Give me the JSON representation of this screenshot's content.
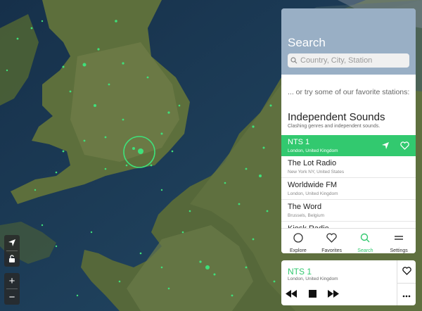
{
  "colors": {
    "accent": "#32c96f",
    "map_dot": "#3fe07a",
    "sea": "#1c3a55"
  },
  "map_controls": {
    "locate_icon": "locate-arrow-icon",
    "lock_icon": "unlock-icon",
    "zoom_in_label": "+",
    "zoom_out_label": "−"
  },
  "search": {
    "title": "Search",
    "placeholder": "Country, City, Station",
    "intro": "... or try some of our favorite stations:",
    "section_title": "Independent Sounds",
    "section_subtitle": "Clashing genres and independent sounds."
  },
  "stations": [
    {
      "name": "NTS 1",
      "location": "London, United Kingdom",
      "active": true
    },
    {
      "name": "The Lot Radio",
      "location": "New York NY, United States",
      "active": false
    },
    {
      "name": "Worldwide FM",
      "location": "London, United Kingdom",
      "active": false
    },
    {
      "name": "The Word",
      "location": "Brussels, Belgium",
      "active": false
    },
    {
      "name": "Kiosk Radio",
      "location": "",
      "active": false
    }
  ],
  "tabs": [
    {
      "label": "Explore",
      "icon": "circle-icon",
      "active": false
    },
    {
      "label": "Favorites",
      "icon": "heart-icon",
      "active": false
    },
    {
      "label": "Search",
      "icon": "search-icon",
      "active": true
    },
    {
      "label": "Settings",
      "icon": "menu-icon",
      "active": false
    }
  ],
  "now_playing": {
    "name": "NTS 1",
    "location": "London, United Kingdom"
  }
}
